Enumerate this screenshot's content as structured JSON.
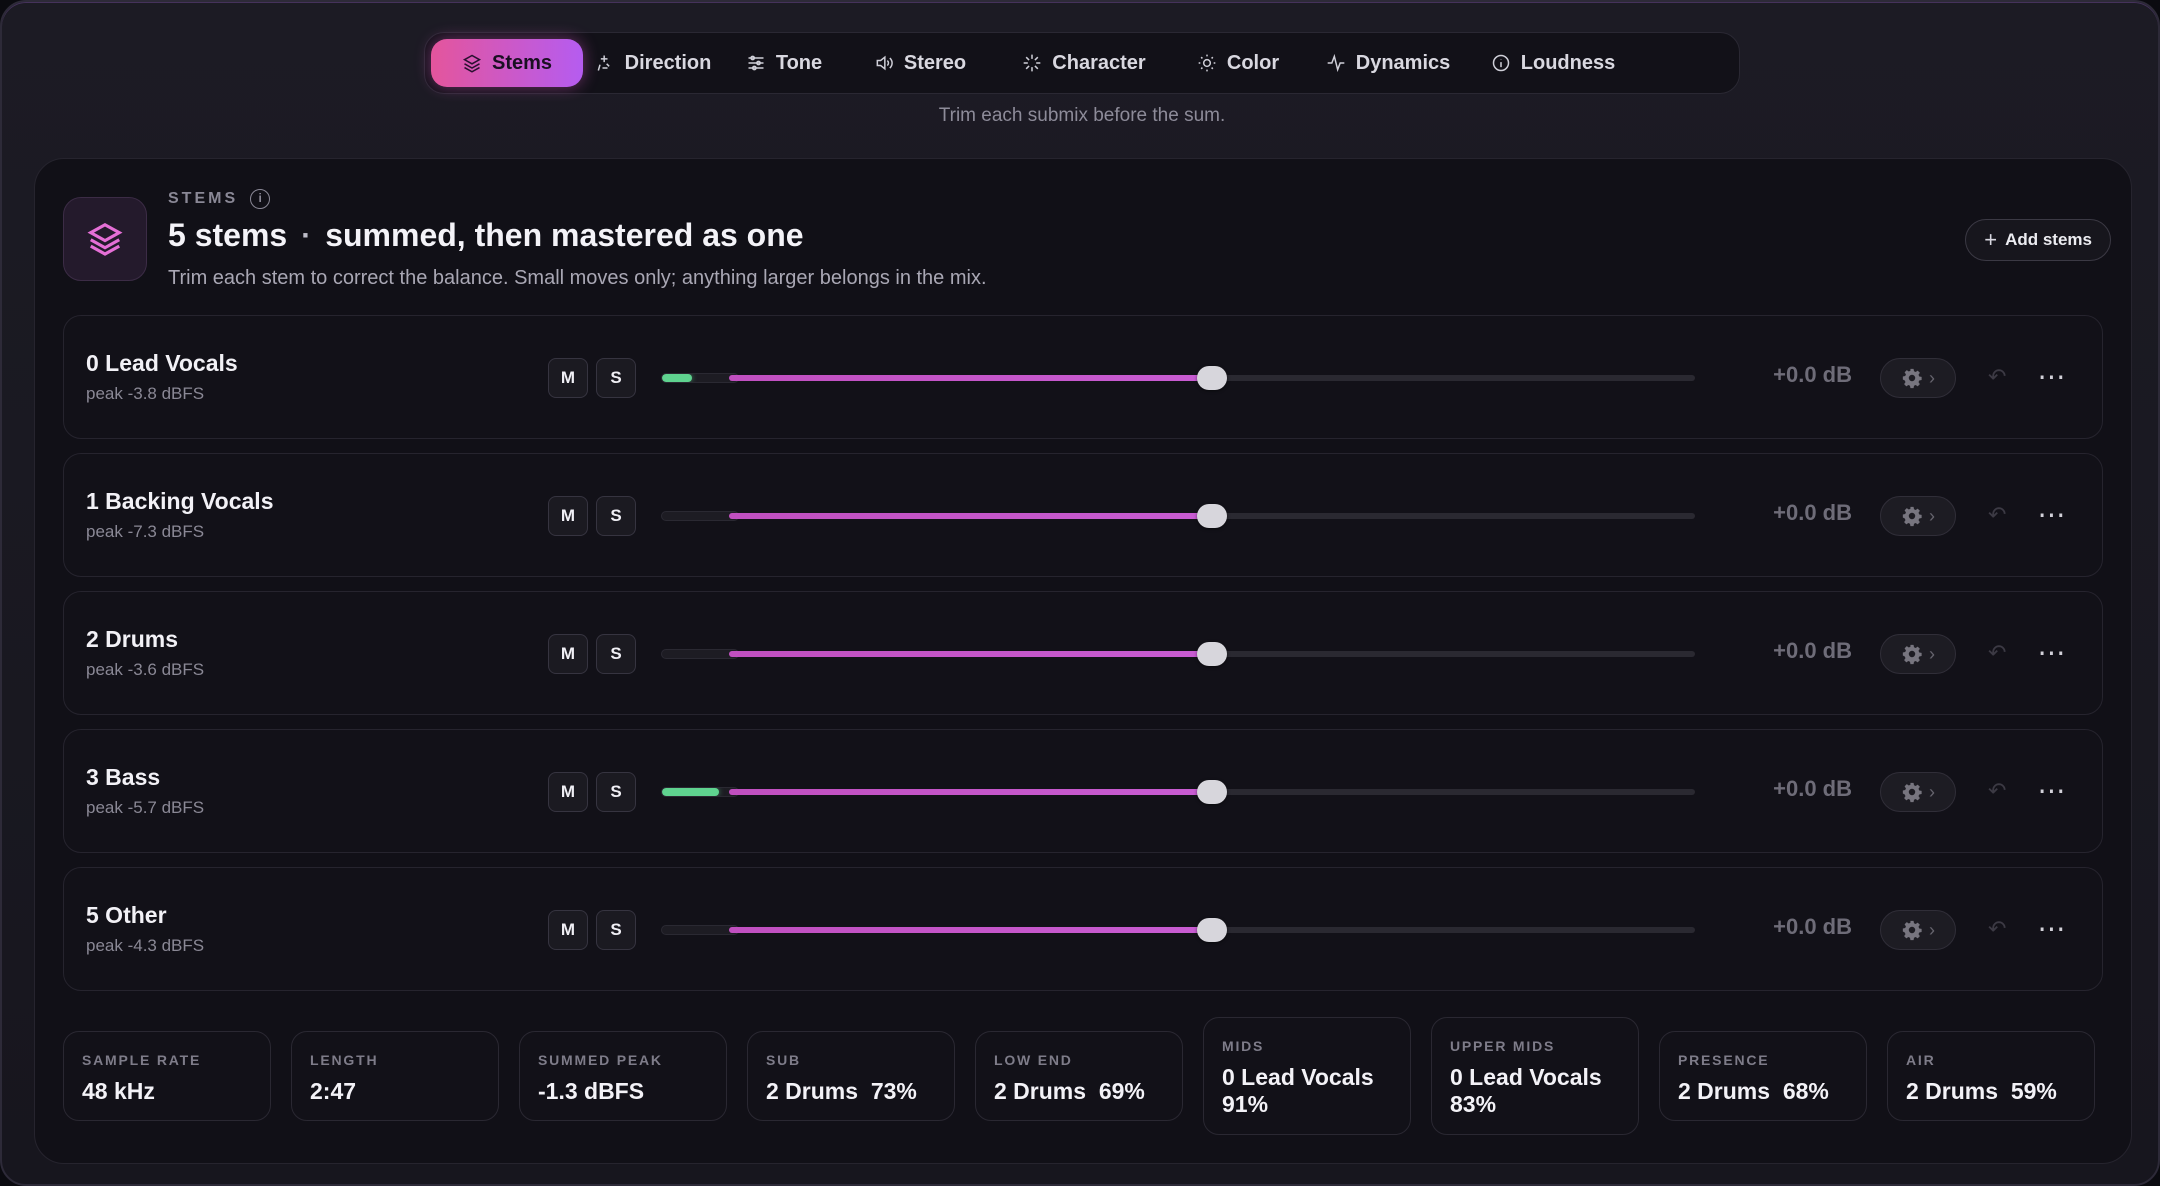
{
  "tabs": [
    {
      "label": "Stems",
      "icon": "layers-icon",
      "active": true
    },
    {
      "label": "Direction",
      "icon": "sparkle-icon",
      "active": false
    },
    {
      "label": "Tone",
      "icon": "sliders-icon",
      "active": false
    },
    {
      "label": "Stereo",
      "icon": "speaker-icon",
      "active": false
    },
    {
      "label": "Character",
      "icon": "burst-icon",
      "active": false
    },
    {
      "label": "Color",
      "icon": "sun-icon",
      "active": false
    },
    {
      "label": "Dynamics",
      "icon": "pulse-icon",
      "active": false
    },
    {
      "label": "Loudness",
      "icon": "info-circle-icon",
      "active": false
    }
  ],
  "tab_subtitle": "Trim each submix before the sum.",
  "panel": {
    "eyebrow": "STEMS",
    "info_glyph": "i",
    "title_count": "5 stems",
    "title_separator": "·",
    "title_rest": "summed, then mastered as one",
    "description": "Trim each stem to correct the balance. Small moves only; anything larger belongs in the mix.",
    "add_button": "Add stems",
    "add_glyph": "+"
  },
  "controls": {
    "mute": "M",
    "solo": "S",
    "undo_glyph": "↶",
    "more_glyph": "⋯",
    "chevron_glyph": "›"
  },
  "stems": [
    {
      "name": "0 Lead Vocals",
      "peak": "peak -3.8 dBFS",
      "meter": 0.4,
      "gain_position": 0.5,
      "gain": "+0.0 dB"
    },
    {
      "name": "1 Backing Vocals",
      "peak": "peak -7.3 dBFS",
      "meter": 0.0,
      "gain_position": 0.5,
      "gain": "+0.0 dB"
    },
    {
      "name": "2 Drums",
      "peak": "peak -3.6 dBFS",
      "meter": 0.0,
      "gain_position": 0.5,
      "gain": "+0.0 dB"
    },
    {
      "name": "3 Bass",
      "peak": "peak -5.7 dBFS",
      "meter": 0.75,
      "gain_position": 0.5,
      "gain": "+0.0 dB"
    },
    {
      "name": "5 Other",
      "peak": "peak -4.3 dBFS",
      "meter": 0.0,
      "gain_position": 0.5,
      "gain": "+0.0 dB"
    }
  ],
  "stats": [
    {
      "label": "SAMPLE RATE",
      "value": "48 kHz"
    },
    {
      "label": "LENGTH",
      "value": "2:47"
    },
    {
      "label": "SUMMED PEAK",
      "value": "-1.3 dBFS"
    },
    {
      "label": "SUB",
      "value": "2 Drums  73%"
    },
    {
      "label": "LOW END",
      "value": "2 Drums  69%"
    },
    {
      "label": "MIDS",
      "value": "0 Lead Vocals 91%"
    },
    {
      "label": "UPPER MIDS",
      "value": "0 Lead Vocals 83%"
    },
    {
      "label": "PRESENCE",
      "value": "2 Drums  68%"
    },
    {
      "label": "AIR",
      "value": "2 Drums  59%"
    }
  ],
  "colors": {
    "accent_start": "#e4559c",
    "accent_end": "#b55cf0",
    "meter_green": "#5fd38f",
    "track_fill": "#c04fbf"
  }
}
